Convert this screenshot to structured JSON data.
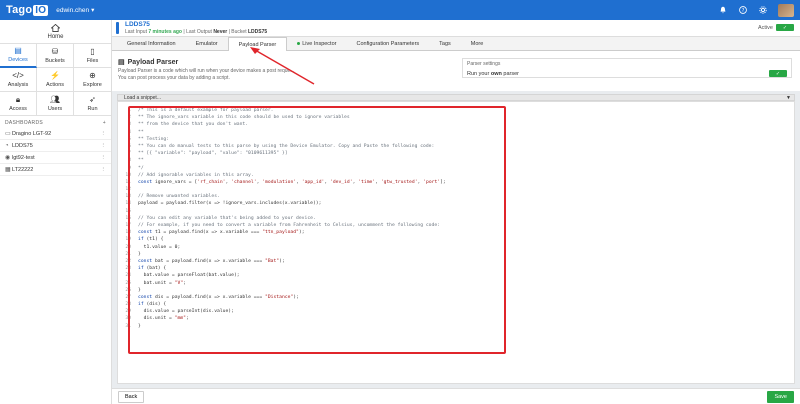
{
  "topbar": {
    "logo_main": "Tago",
    "logo_io": "IO",
    "user_name": "edwin.chen"
  },
  "sidebar": {
    "home_label": "Home",
    "tiles": [
      "Devices",
      "Buckets",
      "Files",
      "Analysis",
      "Actions",
      "Explore",
      "Access",
      "Users",
      "Run"
    ],
    "dashboards_label": "DASHBOARDS",
    "dashboards": [
      "Dragino LGT-92",
      "LDDS75",
      "lgt92-test",
      "LT22222"
    ]
  },
  "device": {
    "name": "LDDS75",
    "last_input_label": "Last Input",
    "last_input_value": "7 minutes ago",
    "last_output_label": "Last Output",
    "last_output_value": "Never",
    "bucket_label": "Bucket",
    "bucket_value": "LDDS75",
    "active_label": "Active"
  },
  "tabs": [
    "General Information",
    "Emulator",
    "Payload Parser",
    "Live Inspector",
    "Configuration Parameters",
    "Tags",
    "More"
  ],
  "parser": {
    "title": "Payload Parser",
    "desc1": "Payload Parser is a code which will run when your device makes a post reque...",
    "desc2": "You can post process your data by adding a script.",
    "settings_label": "Parser settings",
    "run_label_1": "Run your ",
    "run_label_bold": "own",
    "run_label_2": " parser"
  },
  "snippet_label": "Load a snippet...",
  "buttons": {
    "back": "Back",
    "save": "Save"
  },
  "code_lines": [
    "/* This is a default example for payload parser.",
    "** The ignore_vars variable in this code should be used to ignore variables",
    "** from the device that you don't want.",
    "**",
    "** Testing:",
    "** You can do manual tests to this parse by using the Device Emulator. Copy and Paste the following code:",
    "** [{ \"variable\": \"payload\", \"value\": \"0109611395\" }]",
    "**",
    "*/",
    "// Add ignorable variables in this array.",
    "const ignore_vars = ['rf_chain', 'channel', 'modulation', 'app_id', 'dev_id', 'time', 'gtw_trusted', 'port'];",
    "",
    "// Remove unwanted variables.",
    "payload = payload.filter(x => !ignore_vars.includes(x.variable));",
    "",
    "// You can edit any variable that's being added to your device.",
    "// For example, if you need to convert a variable from Fahrenheit to Celsius, uncomment the following code:",
    "const t1 = payload.find(x => x.variable === \"ttn_payload\");",
    "if (t1) {",
    "  t1.value = 0;",
    "}",
    "const bat = payload.find(x => x.variable === \"Bat\");",
    "if (bat) {",
    "  bat.value = parseFloat(bat.value);",
    "  bat.unit = \"V\";",
    "}",
    "const dis = payload.find(x => x.variable === \"Distance\");",
    "if (dis) {",
    "  dis.value = parseInt(dis.value);",
    "  dis.unit = \"mm\";",
    "}"
  ],
  "colors": {
    "brand": "#1f6fd0",
    "success": "#28a745",
    "highlight": "#e0252b"
  }
}
